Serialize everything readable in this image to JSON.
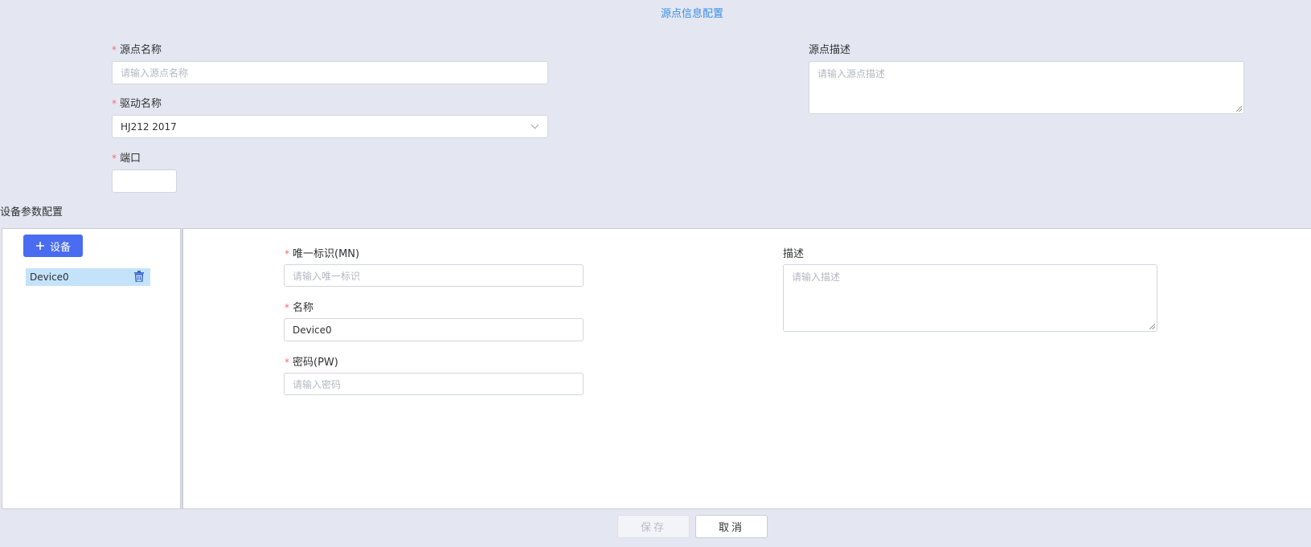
{
  "page_title": "源点信息配置",
  "source": {
    "name_label": "源点名称",
    "name_placeholder": "请输入源点名称",
    "driver_label": "驱动名称",
    "driver_value": "HJ212 2017",
    "port_label": "端口",
    "port_value": "",
    "desc_label": "源点描述",
    "desc_placeholder": "请输入源点描述"
  },
  "device_section": {
    "title": "设备参数配置",
    "add_button_label": "设备",
    "devices": [
      "Device0"
    ]
  },
  "device_form": {
    "mn_label": "唯一标识(MN)",
    "mn_placeholder": "请输入唯一标识",
    "name_label": "名称",
    "name_value": "Device0",
    "pw_label": "密码(PW)",
    "pw_placeholder": "请输入密码",
    "desc_label": "描述",
    "desc_placeholder": "请输入描述"
  },
  "footer": {
    "save_label": "保存",
    "cancel_label": "取消"
  },
  "icons": {
    "add": "plus-icon",
    "delete": "trash-icon",
    "dropdown": "chevron-down-icon"
  },
  "colors": {
    "accent": "#4a6cf0",
    "title": "#3a8ee6",
    "required": "#f56c6c",
    "selected_item": "#c4e3fb",
    "background": "#e4e7f1"
  }
}
